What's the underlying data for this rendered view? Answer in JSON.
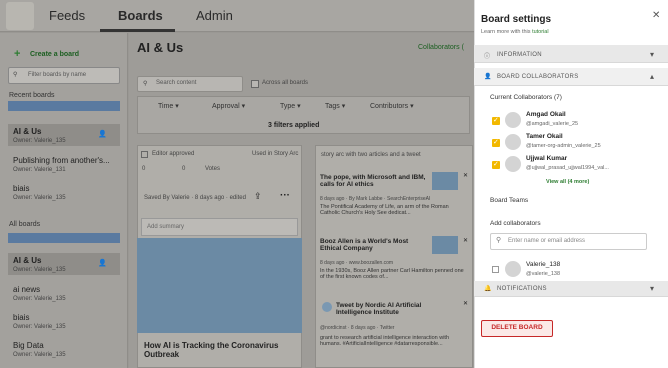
{
  "nav": {
    "tabs": [
      "Feeds",
      "Boards",
      "Admin"
    ]
  },
  "sidebar": {
    "create_label": "Create a board",
    "filter_placeholder": "Filter boards by name",
    "recent_title": "Recent boards",
    "recent": [
      {
        "name": "AI & Us",
        "owner": "Owner: Valerie_135",
        "selected": true
      },
      {
        "name": "Publishing from another's...",
        "owner": "Owner: Valerie_131"
      },
      {
        "name": "biais",
        "owner": "Owner: Valerie_135"
      }
    ],
    "all_title": "All boards",
    "all": [
      {
        "name": "AI & Us",
        "owner": "Owner: Valerie_135",
        "selected": true
      },
      {
        "name": "ai news",
        "owner": "Owner: Valerie_135"
      },
      {
        "name": "biais",
        "owner": "Owner: Valerie_135"
      },
      {
        "name": "Big Data",
        "owner": "Owner: Valerie_135"
      }
    ]
  },
  "main": {
    "title": "AI & Us",
    "collaborators_label": "Collaborators (",
    "search_placeholder": "Search content",
    "across_label": "Across all boards",
    "filters": [
      "Time",
      "Approval",
      "Type",
      "Tags",
      "Contributors"
    ],
    "filters_applied": "3 filters applied",
    "card1": {
      "editor_approved": "Editor approved",
      "used_in": "Used in Story Arc",
      "saved_by": "Saved By Valerie · 8 days ago · edited",
      "add_summary": "Add summary",
      "title": "How AI is Tracking the Coronavirus Outbreak",
      "counts": [
        "0",
        "0",
        "Votes"
      ]
    },
    "card2": {
      "header": "story arc with two articles and a tweet",
      "items": [
        {
          "title": "The pope, with Microsoft and IBM, calls for AI ethics",
          "meta": "8 days ago · By Mark Labbe · SearchEnterpriseAI",
          "text": "The Pontifical Academy of Life, an arm of the Roman Catholic Church's Holy See dedicat..."
        },
        {
          "title": "Booz Allen is a World's Most Ethical Company",
          "meta": "8 days ago · www.boozallen.com",
          "text": "In the 1930s, Booz Allen partner Carl Hamilton penned one of the first known codes of..."
        },
        {
          "title": "Tweet by Nordic AI Artificial Intelligence Institute",
          "meta": "@nordicinst · 8 days ago · Twitter",
          "text": "grant to research artificial intelligence interaction with humans. #ArtificialIntelligence #datarresponsible..."
        }
      ]
    }
  },
  "panel": {
    "title": "Board settings",
    "learn": "Learn more with this",
    "tutorial": "tutorial",
    "information": "INFORMATION",
    "collaborators_header": "BOARD COLLABORATORS",
    "current_label": "Current Collaborators (7)",
    "collaborators": [
      {
        "name": "Amgad Okail",
        "handle": "@amgadi_valerie_25"
      },
      {
        "name": "Tamer Okail",
        "handle": "@tamer-org-admin_valerie_25"
      },
      {
        "name": "Ujjwal Kumar",
        "handle": "@ujjwal_prasad_ujjwal1994_val..."
      }
    ],
    "view_all": "View all (4 more)",
    "board_teams": "Board Teams",
    "add_collab": "Add collaborators",
    "input_placeholder": "Enter name or email address",
    "candidate": {
      "name": "Valerie_138",
      "handle": "@valerie_138"
    },
    "notifications": "NOTIFICATIONS",
    "delete_label": "DELETE BOARD"
  }
}
